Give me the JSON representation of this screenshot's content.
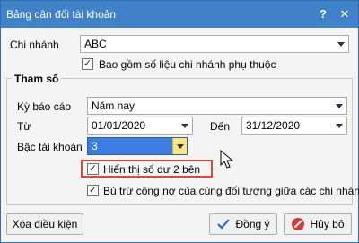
{
  "window": {
    "title": "Bảng cân đối tài khoản",
    "help_symbol": "?",
    "close_symbol": "✕"
  },
  "branch": {
    "label": "Chi nhánh",
    "value": "ABC",
    "include_label": "Bao gồm số liệu chi nhánh phụ thuộc",
    "include_checked": true
  },
  "params": {
    "group_title": "Tham số",
    "period_label": "Kỳ báo cáo",
    "period_value": "Năm nay",
    "from_label": "Từ",
    "from_value": "01/01/2020",
    "to_label": "Đến",
    "to_value": "31/12/2020",
    "level_label": "Bậc tài khoản",
    "level_value": "3",
    "show_both_label": "Hiển thị số dư 2 bên",
    "show_both_checked": true,
    "offset_label": "Bù trừ công nợ của cùng đối tượng giữa các chi nhánh",
    "offset_checked": true
  },
  "footer": {
    "clear_label": "Xóa điều kiện",
    "ok_label": "Đồng ý",
    "cancel_label": "Hủy bỏ"
  },
  "colors": {
    "titlebar": "#3f82c8",
    "highlight": "#e2453c",
    "selected_field": "#3b7de0"
  }
}
